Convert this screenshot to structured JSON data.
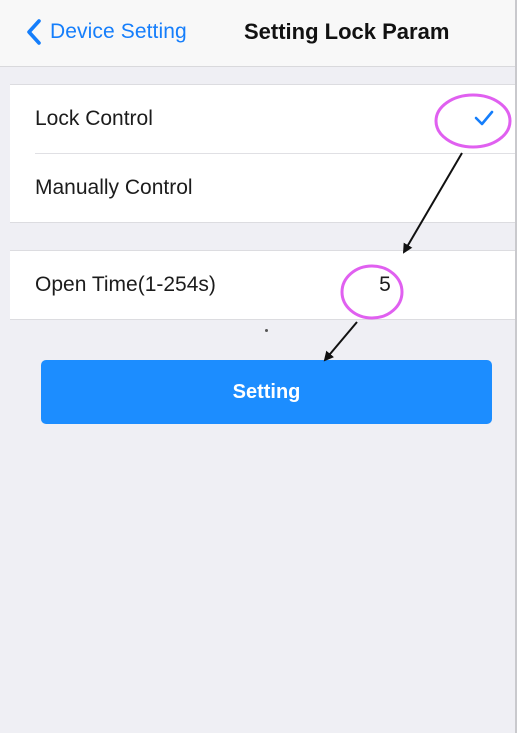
{
  "nav": {
    "back_label": "Device Setting",
    "title": "Setting Lock Param"
  },
  "control_group": {
    "items": [
      {
        "label": "Lock Control",
        "selected": true
      },
      {
        "label": "Manually Control",
        "selected": false
      }
    ]
  },
  "open_time": {
    "label": "Open Time(1-254s)",
    "value": "5"
  },
  "setting_button": {
    "label": "Setting"
  },
  "colors": {
    "accent": "#157efb",
    "button": "#1c8dff",
    "annotation": "#e060f0",
    "background": "#efeff4"
  },
  "icons": {
    "back": "chevron-left-icon",
    "selected": "checkmark-icon"
  }
}
